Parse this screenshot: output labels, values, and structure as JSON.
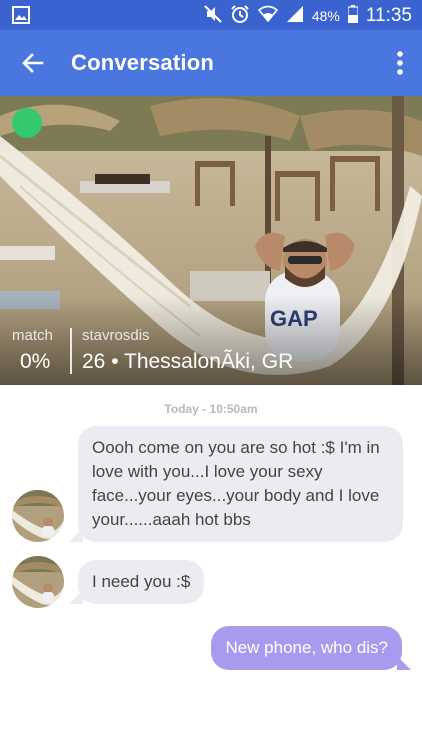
{
  "status_bar": {
    "icons": [
      "gallery-icon",
      "mute-icon",
      "alarm-icon",
      "wifi-icon",
      "signal-icon",
      "battery-icon"
    ],
    "battery": "48%",
    "time": "11:35",
    "background": "#3a63cf"
  },
  "app_bar": {
    "title": "Conversation",
    "back_icon": "arrow-left-icon",
    "menu_icon": "more-vert-icon",
    "background": "#4a76e0"
  },
  "profile": {
    "online": true,
    "online_color": "#33c96c",
    "match_label": "match",
    "match_value": "0%",
    "username": "stavrosdis",
    "info": "26 • ThessalonÃki, GR"
  },
  "chat": {
    "date_label": "Today - 10:50am",
    "messages": [
      {
        "from": "them",
        "text": "Oooh come on you are so hot :$ I'm in love with you...I love your sexy face...your eyes...your body and I love your......aaah hot bbs"
      },
      {
        "from": "them",
        "text": "I need you :$"
      },
      {
        "from": "me",
        "text": "New phone, who dis?"
      }
    ],
    "incoming_color": "#ebebf1",
    "outgoing_color": "#a79bf0"
  }
}
